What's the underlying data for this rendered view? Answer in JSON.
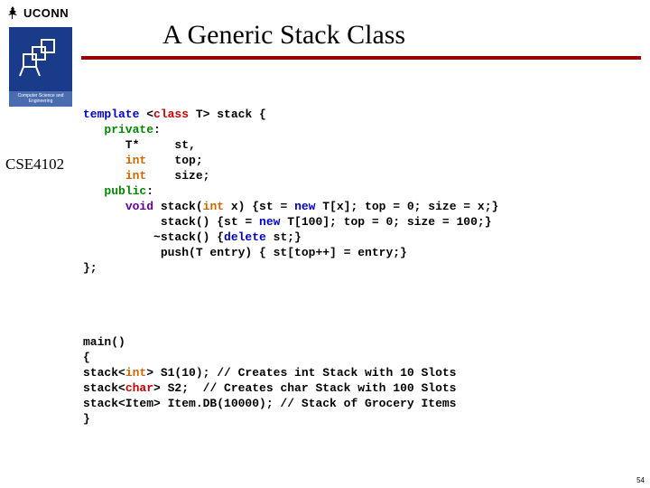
{
  "header": {
    "uconn": "UCONN",
    "title": "A Generic Stack Class",
    "course": "CSE4102",
    "dept_band": "Computer Science and Engineering"
  },
  "code1": {
    "l1a": "template",
    "l1b": " <",
    "l1c": "class",
    "l1d": " T> stack {",
    "l2a": "   private",
    "l2b": ":",
    "l3a": "      T*     st,",
    "l4a": "      ",
    "l4b": "int",
    "l4c": "    top;",
    "l5a": "      ",
    "l5b": "int",
    "l5c": "    size;",
    "l6a": "   public",
    "l6b": ":",
    "l7a": "      ",
    "l7b": "void",
    "l7c": " stack(",
    "l7d": "int",
    "l7e": " x) {st = ",
    "l7f": "new",
    "l7g": " T[x]; top = 0; size = x;}",
    "l8a": "           stack() {st = ",
    "l8b": "new",
    "l8c": " T[100]; top = 0; size = 100;}",
    "l9a": "          ~stack() {",
    "l9b": "delete",
    "l9c": " st;}",
    "l10a": "           push(T entry) { st[top++] = entry;}",
    "l11a": "};"
  },
  "code2": {
    "l1": "main()",
    "l2": "{",
    "l3a": "stack<",
    "l3b": "int",
    "l3c": "> S1(10); // Creates int Stack with 10 Slots",
    "l4a": "stack<",
    "l4b": "char",
    "l4c": "> S2;  // Creates char Stack with 100 Slots",
    "l5": "stack<Item> Item.DB(10000); // Stack of Grocery Items",
    "l6": "}"
  },
  "page": "54"
}
